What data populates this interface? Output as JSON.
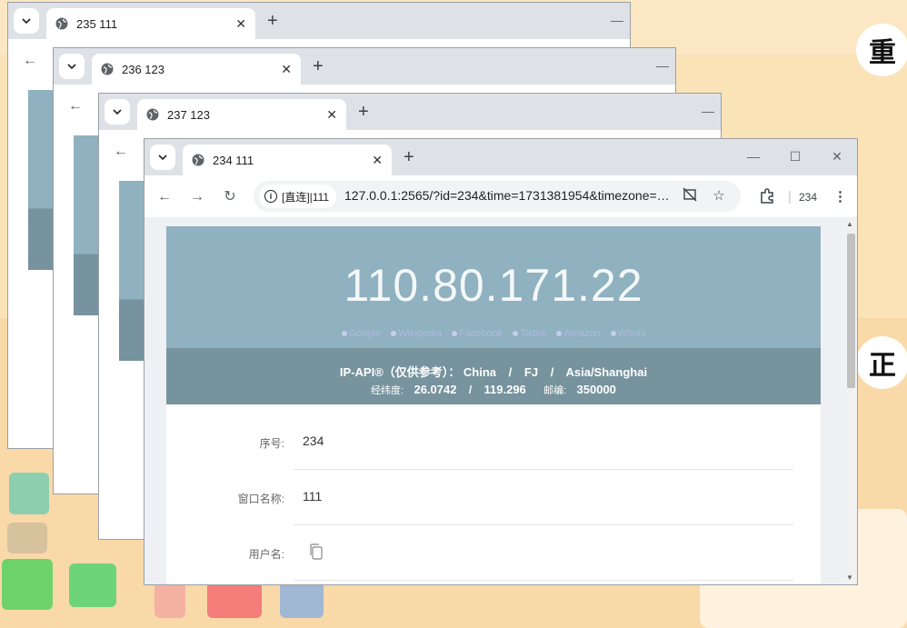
{
  "desktop": {
    "right_labels": [
      "重",
      "正"
    ]
  },
  "windows": [
    {
      "tab_title": "235 111"
    },
    {
      "tab_title": "236 123"
    },
    {
      "tab_title": "237 123"
    }
  ],
  "active_window": {
    "tab_title": "234 111",
    "site_chip": "[直连]|111",
    "url": "127.0.0.1:2565/?id=234&time=1731381954&timezone=Asia/Shanghai",
    "profile_label": "234"
  },
  "page": {
    "ip": "110.80.171.22",
    "links": [
      "Google",
      "Wikipedia",
      "Facebook",
      "Tiktok",
      "Amazon",
      "Whois"
    ],
    "geo": {
      "source_label": "IP-API®（仅供参考）：",
      "country": "China",
      "region": "FJ",
      "timezone": "Asia/Shanghai",
      "sep": "/",
      "coord_label": "经纬度:",
      "lat": "26.0742",
      "lon": "119.296",
      "zip_label": "邮编:",
      "zip": "350000"
    },
    "fields": [
      {
        "label": "序号:",
        "value": "234"
      },
      {
        "label": "窗口名称:",
        "value": "111"
      },
      {
        "label": "用户名:",
        "value": ""
      }
    ]
  }
}
